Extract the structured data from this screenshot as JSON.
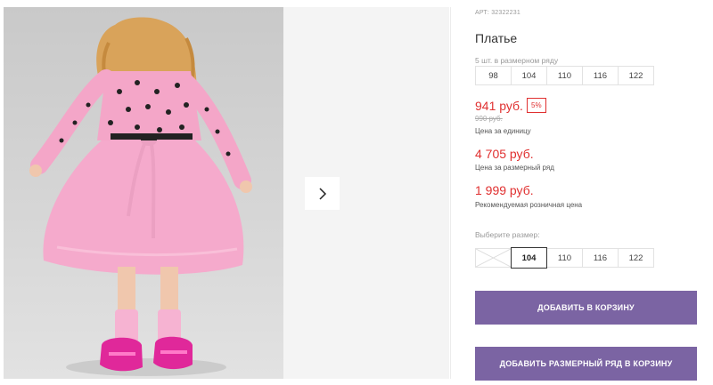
{
  "product": {
    "sku": "АРТ: 32322231",
    "title": "Платье",
    "series_label": "5 шт. в размерном ряду",
    "series_sizes": [
      "98",
      "104",
      "110",
      "116",
      "122"
    ],
    "price": "941 руб.",
    "discount": "5%",
    "old_price": "990 руб.",
    "price_unit_note": "Цена за единицу",
    "series_price": "4 705 руб.",
    "series_price_note": "Цена за размерный ряд",
    "retail_price": "1 999 руб.",
    "retail_price_note": "Рекомендуемая розничная цена",
    "choose_size_label": "Выберите размер:",
    "size_options": [
      {
        "label": "",
        "state": "disabled"
      },
      {
        "label": "104",
        "state": "selected"
      },
      {
        "label": "110",
        "state": "available"
      },
      {
        "label": "116",
        "state": "available"
      },
      {
        "label": "122",
        "state": "available"
      }
    ],
    "add_to_cart": "ДОБАВИТЬ В КОРЗИНУ",
    "add_series_to_cart": "ДОБАВИТЬ РАЗМЕРНЫЙ РЯД В КОРЗИНУ"
  },
  "gallery": {
    "next_icon": "chevron-right-icon"
  },
  "colors": {
    "accent_button": "#7b64a3",
    "price_red": "#e03030",
    "dress_pink": "#f4a6c8"
  }
}
